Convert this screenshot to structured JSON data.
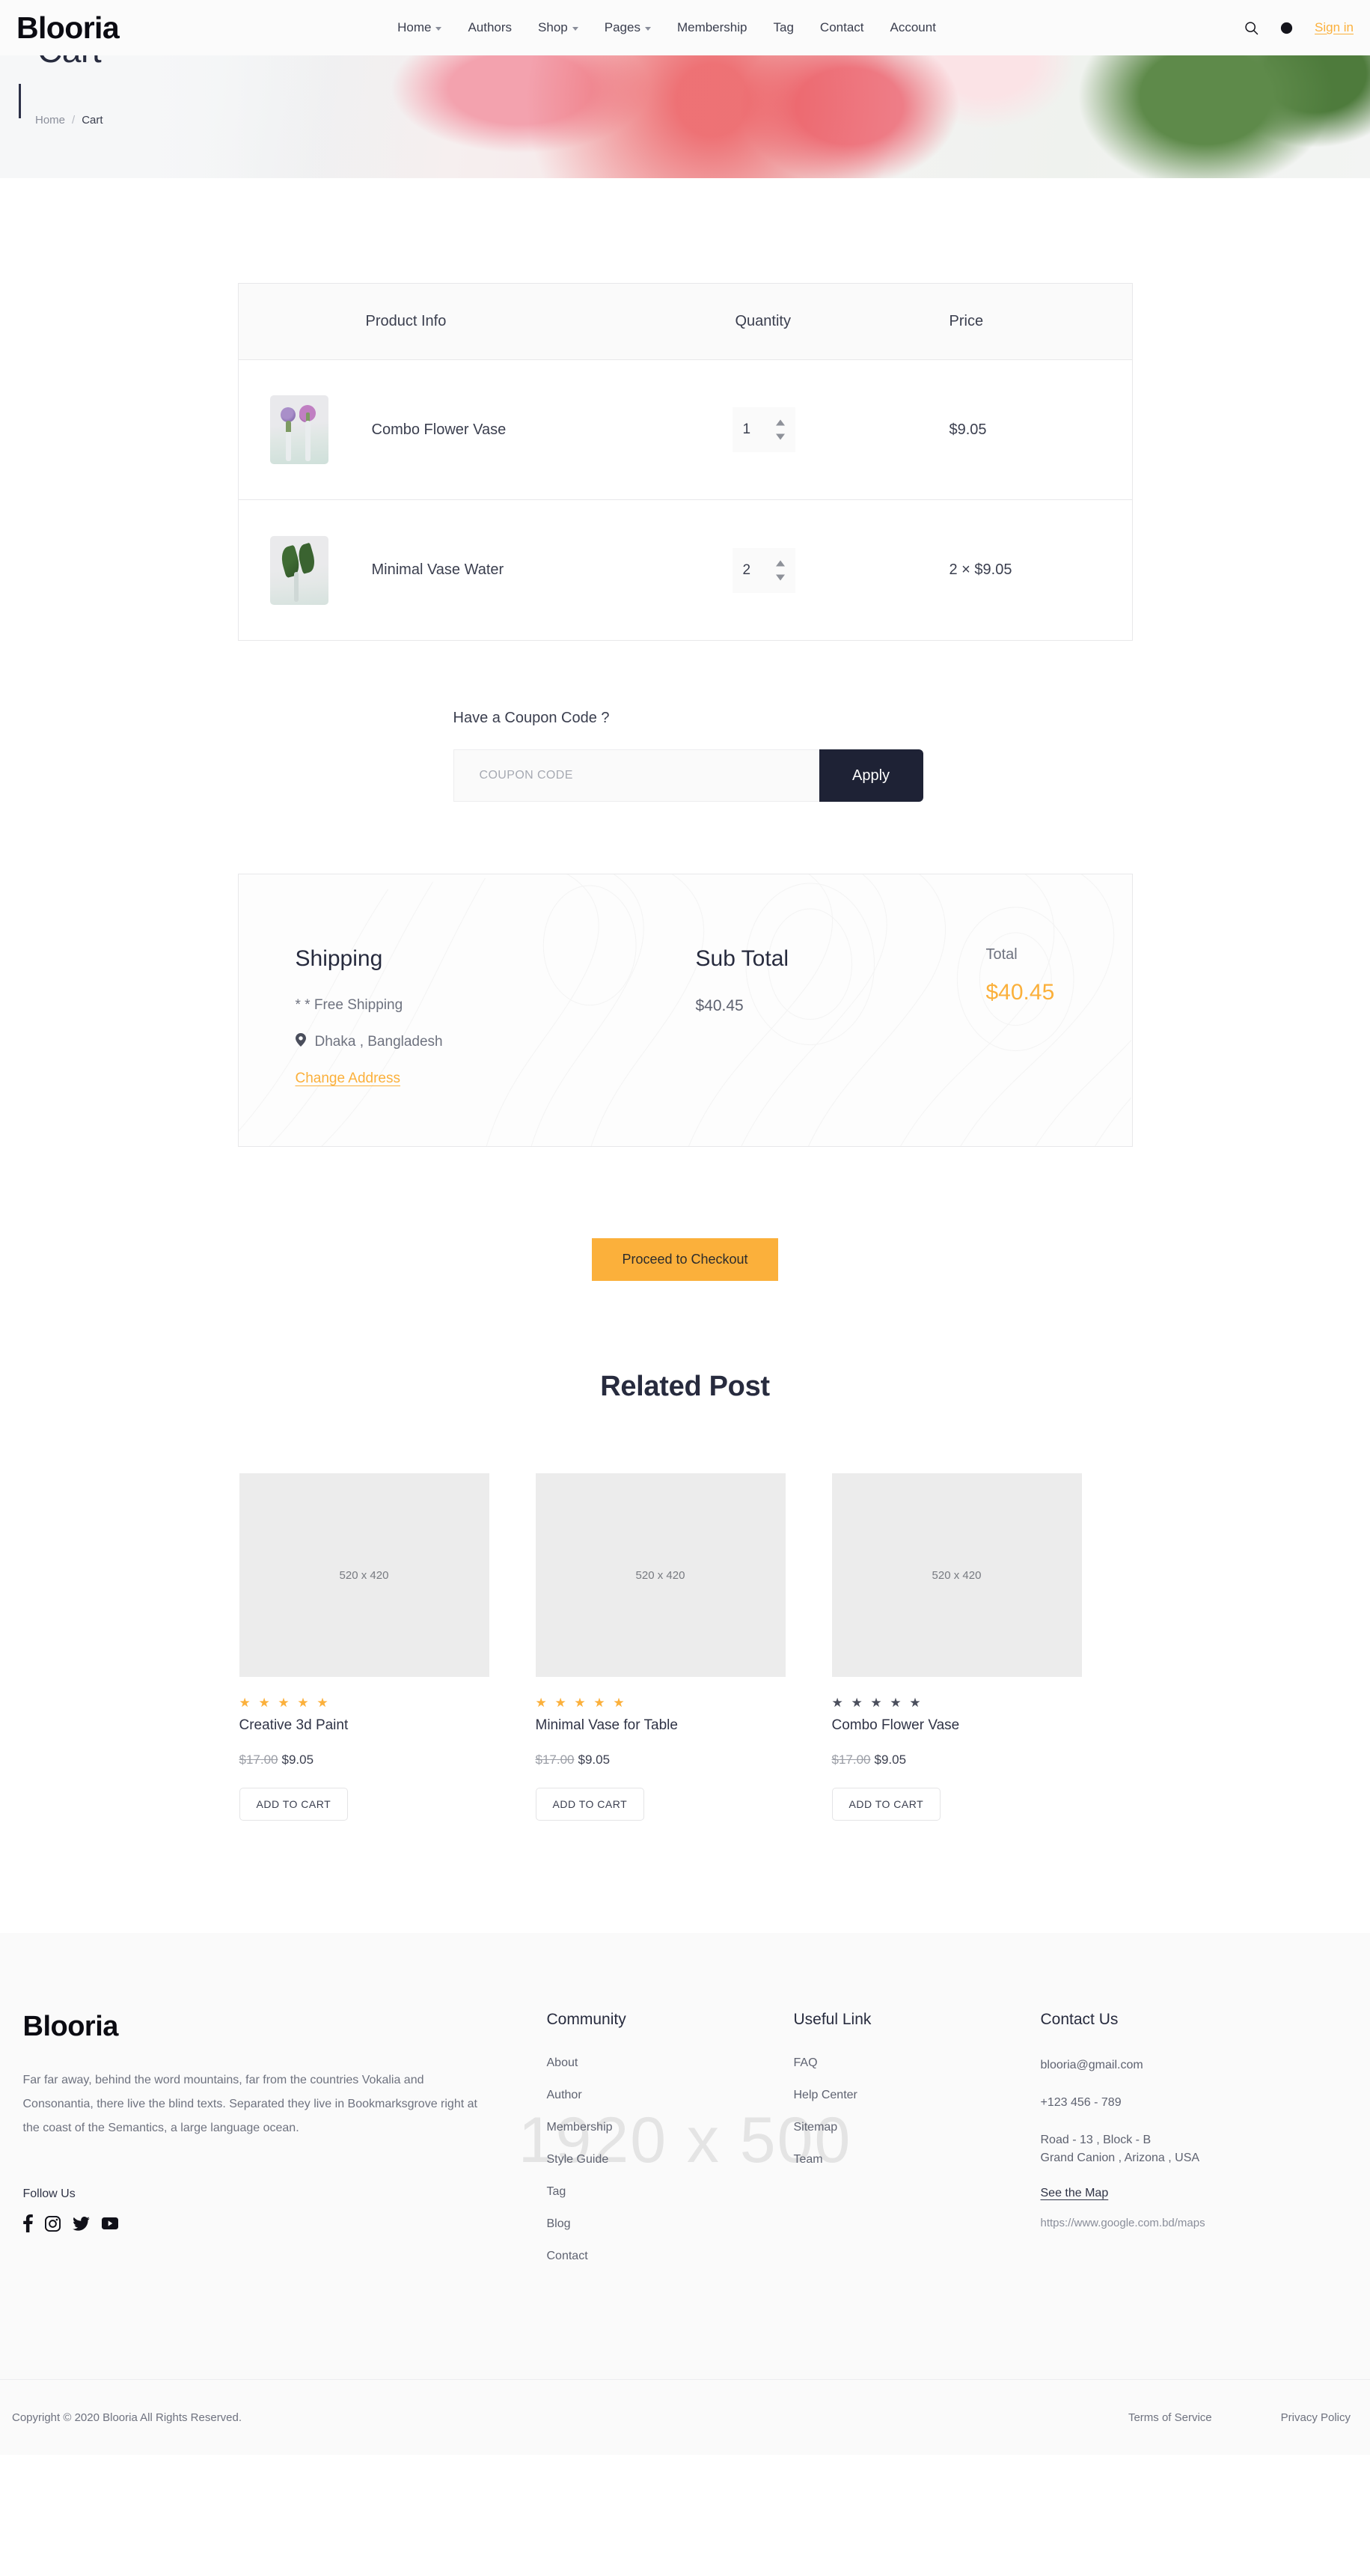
{
  "header": {
    "brand": "Blooria",
    "nav": [
      {
        "label": "Home",
        "caret": true
      },
      {
        "label": "Authors",
        "caret": false
      },
      {
        "label": "Shop",
        "caret": true
      },
      {
        "label": "Pages",
        "caret": true
      },
      {
        "label": "Membership",
        "caret": false
      },
      {
        "label": "Tag",
        "caret": false
      },
      {
        "label": "Contact",
        "caret": false
      },
      {
        "label": "Account",
        "caret": false
      }
    ],
    "search_icon": "search-icon",
    "theme_icon": "dark-mode-icon",
    "signin": "Sign in"
  },
  "hero": {
    "title": "Cart",
    "breadcrumb": {
      "home": "Home",
      "separator": "/",
      "current": "Cart"
    }
  },
  "cart": {
    "columns": {
      "product": "Product Info",
      "quantity": "Quantity",
      "price": "Price"
    },
    "rows": [
      {
        "name": "Combo Flower Vase",
        "quantity": "1",
        "price": "$9.05",
        "thumb": "flower-vase-thumbnail"
      },
      {
        "name": "Minimal Vase Water",
        "quantity": "2",
        "price": "2 × $9.05",
        "thumb": "leaf-vase-thumbnail"
      }
    ]
  },
  "coupon": {
    "label": "Have a Coupon Code ?",
    "placeholder": "COUPON CODE",
    "value": "",
    "apply_label": "Apply"
  },
  "summary": {
    "shipping_title": "Shipping",
    "shipping_note": "* * Free Shipping",
    "location": "Dhaka , Bangladesh",
    "change_address": "Change Address",
    "subtotal_label": "Sub Total",
    "subtotal_value": "$40.45",
    "total_label": "Total",
    "total_value": "$40.45",
    "accent_color": "#FBB03B"
  },
  "checkout": {
    "label": "Proceed to Checkout"
  },
  "related": {
    "title": "Related Post",
    "products": [
      {
        "placeholder": "520 x 420",
        "stars": "★ ★ ★ ★ ★",
        "star_style": "gold",
        "name": "Creative 3d Paint",
        "old_price": "$17.00",
        "new_price": "$9.05",
        "button": "ADD TO CART"
      },
      {
        "placeholder": "520 x 420",
        "stars": "★ ★ ★ ★ ★",
        "star_style": "gold",
        "name": "Minimal Vase for Table",
        "old_price": "$17.00",
        "new_price": "$9.05",
        "button": "ADD TO CART"
      },
      {
        "placeholder": "520 x 420",
        "stars": "★ ★ ★ ★ ★",
        "star_style": "grey",
        "name": "Combo Flower Vase",
        "old_price": "$17.00",
        "new_price": "$9.05",
        "button": "ADD TO CART"
      }
    ]
  },
  "footer": {
    "watermark": "1920 x 500",
    "brand": "Blooria",
    "description": "Far far away, behind the word mountains, far from the countries Vokalia and Consonantia, there live the blind texts. Separated they live in Bookmarksgrove right at the coast of the Semantics, a large language ocean.",
    "follow_label": "Follow Us",
    "socials": [
      {
        "name": "facebook-icon"
      },
      {
        "name": "instagram-icon"
      },
      {
        "name": "twitter-icon"
      },
      {
        "name": "youtube-icon"
      }
    ],
    "community": {
      "title": "Community",
      "links": [
        "About",
        "Author",
        "Membership",
        "Style Guide",
        "Tag",
        "Blog",
        "Contact"
      ]
    },
    "useful": {
      "title": "Useful Link",
      "links": [
        "FAQ",
        "Help Center",
        "Sitemap",
        "Team"
      ]
    },
    "contact": {
      "title": "Contact Us",
      "email": "blooria@gmail.com",
      "phone": "+123 456 - 789",
      "address_line1": "Road - 13 , Block - B",
      "address_line2": "Grand Canion , Arizona , USA",
      "map_label": "See the Map",
      "map_url": "https://www.google.com.bd/maps"
    },
    "copyright": "Copyright © 2020 Blooria All Rights Reserved.",
    "legal": [
      "Terms of Service",
      "Privacy Policy"
    ]
  }
}
